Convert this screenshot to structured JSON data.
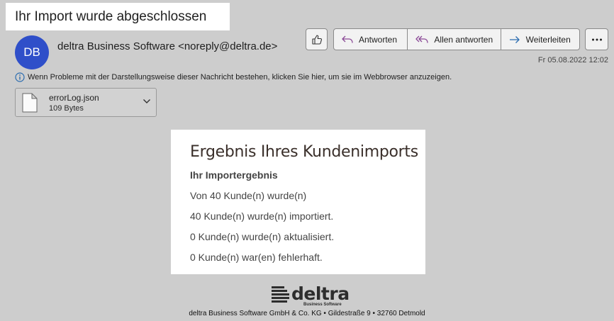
{
  "header": {
    "subject": "Ihr Import wurde abgeschlossen",
    "avatar_initials": "DB",
    "sender": "deltra Business Software <noreply@deltra.de>",
    "date": "Fr 05.08.2022 12:02"
  },
  "toolbar": {
    "reply_label": "Antworten",
    "reply_all_label": "Allen antworten",
    "forward_label": "Weiterleiten"
  },
  "info_bar": {
    "text": "Wenn Probleme mit der Darstellungsweise dieser Nachricht bestehen, klicken Sie hier, um sie im Webbrowser anzuzeigen."
  },
  "attachment": {
    "name": "errorLog.json",
    "size": "109 Bytes"
  },
  "body": {
    "title": "Ergebnis Ihres Kundenimports",
    "subtitle": "Ihr Importergebnis",
    "lines": [
      "Von 40 Kunde(n) wurde(n)",
      "40 Kunde(n) wurde(n) importiert.",
      "0 Kunde(n) wurde(n) aktualisiert.",
      "0 Kunde(n) war(en) fehlerhaft."
    ]
  },
  "logo": {
    "word": "deltra",
    "tagline": "Business Software"
  },
  "footer": {
    "text": "deltra Business Software GmbH & Co. KG • Gildestraße 9 • 32760 Detmold"
  },
  "colors": {
    "avatar": "#2f4fc9",
    "reply_icon": "#8b4a97",
    "forward_icon": "#2b6cb0",
    "info_icon": "#2b6cb0"
  }
}
